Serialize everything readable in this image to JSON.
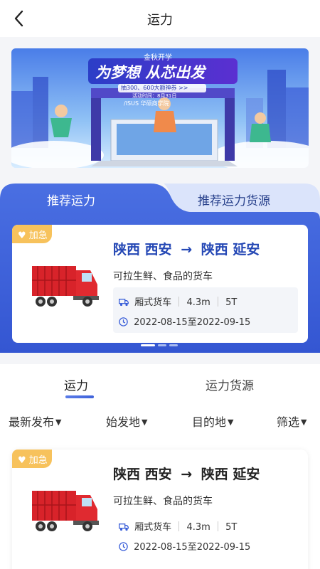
{
  "nav": {
    "title": "运力"
  },
  "banner": {
    "top_tag": "金秋开学",
    "headline": "为梦想 从芯出发",
    "sub": "抽300、600大额神券 >>",
    "date": "活动时间：8月31日",
    "brand": "/ISUS 华硕商学院"
  },
  "recommend": {
    "tabs": [
      {
        "label": "推荐运力"
      },
      {
        "label": "推荐运力货源"
      }
    ],
    "card": {
      "badge": "加急",
      "from": "陕西 西安",
      "to": "陕西 延安",
      "arrow": "→",
      "desc": "可拉生鲜、食品的货车",
      "truck_type": "厢式货车",
      "length": "4.3m",
      "weight": "5T",
      "date_range": "2022-08-15至2022-09-15"
    },
    "colors": {
      "panel": "#3a5fd9",
      "route": "#2548b5"
    }
  },
  "list": {
    "tabs": [
      {
        "label": "运力"
      },
      {
        "label": "运力货源"
      }
    ],
    "filters": [
      {
        "label": "最新发布"
      },
      {
        "label": "始发地"
      },
      {
        "label": "目的地"
      },
      {
        "label": "筛选"
      }
    ],
    "card": {
      "badge": "加急",
      "from": "陕西 西安",
      "to": "陕西 延安",
      "arrow": "→",
      "desc": "可拉生鲜、食品的货车",
      "truck_type": "厢式货车",
      "length": "4.3m",
      "weight": "5T",
      "date_range": "2022-08-15至2022-09-15"
    }
  },
  "icons": {
    "back": "chevron-left-icon",
    "badge": "heart-icon",
    "truck": "truck-icon",
    "clock": "clock-icon",
    "caret": "caret-down-icon"
  }
}
